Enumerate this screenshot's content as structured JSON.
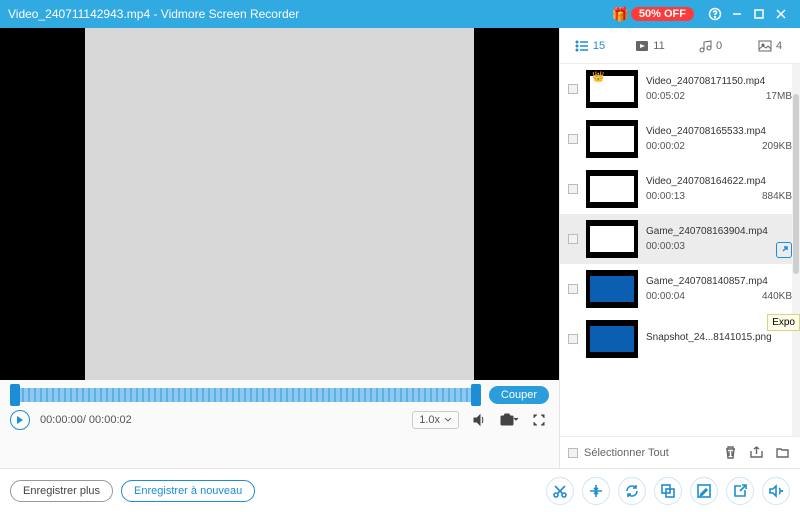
{
  "window": {
    "title": "Video_240711142943.mp4  -  Vidmore Screen Recorder",
    "promo_badge": "50% OFF"
  },
  "tabs": {
    "list_count": "15",
    "video_count": "11",
    "audio_count": "0",
    "image_count": "4"
  },
  "items": [
    {
      "name": "Video_240708171150.mp4",
      "duration": "00:05:02",
      "size": "17MB",
      "thumb": "doc",
      "crown": true
    },
    {
      "name": "Video_240708165533.mp4",
      "duration": "00:00:02",
      "size": "209KB",
      "thumb": "doc"
    },
    {
      "name": "Video_240708164622.mp4",
      "duration": "00:00:13",
      "size": "884KB",
      "thumb": "doc"
    },
    {
      "name": "Game_240708163904.mp4",
      "duration": "00:00:03",
      "size": "",
      "thumb": "doc",
      "selected": true,
      "share": true
    },
    {
      "name": "Game_240708140857.mp4",
      "duration": "00:00:04",
      "size": "440KB",
      "thumb": "blue"
    },
    {
      "name": "Snapshot_24...8141015.png",
      "duration": "",
      "size": "",
      "thumb": "blue"
    }
  ],
  "playback": {
    "cut_label": "Couper",
    "time": "00:00:00/ 00:00:02",
    "speed": "1.0x"
  },
  "select_all": {
    "label": "Sélectionner Tout"
  },
  "footer": {
    "record_more": "Enregistrer plus",
    "record_again": "Enregistrer à nouveau"
  },
  "tooltip": {
    "export": "Expo"
  }
}
